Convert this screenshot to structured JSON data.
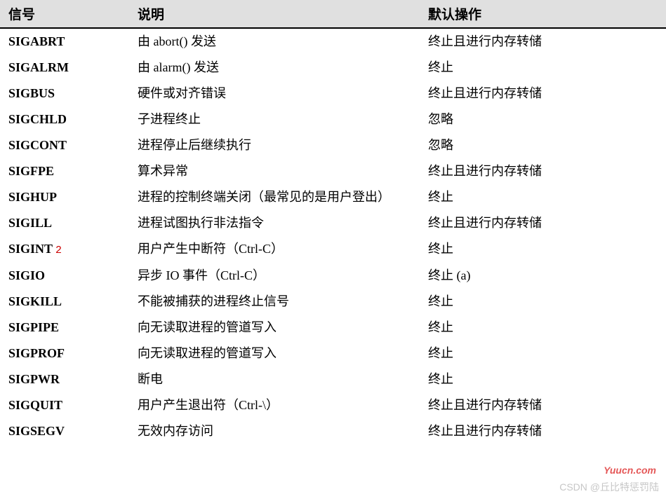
{
  "table": {
    "headers": {
      "signal": "信号",
      "desc": "说明",
      "action": "默认操作"
    },
    "rows": [
      {
        "signal": "SIGABRT",
        "annot": "",
        "desc": "由 abort() 发送",
        "action": "终止且进行内存转储"
      },
      {
        "signal": "SIGALRM",
        "annot": "",
        "desc": "由 alarm() 发送",
        "action": "终止"
      },
      {
        "signal": "SIGBUS",
        "annot": "",
        "desc": "硬件或对齐错误",
        "action": "终止且进行内存转储"
      },
      {
        "signal": "SIGCHLD",
        "annot": "",
        "desc": "子进程终止",
        "action": "忽略"
      },
      {
        "signal": "SIGCONT",
        "annot": "",
        "desc": "进程停止后继续执行",
        "action": "忽略"
      },
      {
        "signal": "SIGFPE",
        "annot": "",
        "desc": "算术异常",
        "action": "终止且进行内存转储"
      },
      {
        "signal": "SIGHUP",
        "annot": "",
        "desc": "进程的控制终端关闭（最常见的是用户登出）",
        "action": "终止"
      },
      {
        "signal": "SIGILL",
        "annot": "",
        "desc": "进程试图执行非法指令",
        "action": "终止且进行内存转储"
      },
      {
        "signal": "SIGINT",
        "annot": "2",
        "desc": "用户产生中断符（Ctrl-C）",
        "action": "终止"
      },
      {
        "signal": "SIGIO",
        "annot": "",
        "desc": "异步 IO 事件（Ctrl-C）",
        "action": "终止 (a)"
      },
      {
        "signal": "SIGKILL",
        "annot": "",
        "desc": "不能被捕获的进程终止信号",
        "action": "终止"
      },
      {
        "signal": "SIGPIPE",
        "annot": "",
        "desc": "向无读取进程的管道写入",
        "action": "终止"
      },
      {
        "signal": "SIGPROF",
        "annot": "",
        "desc": "向无读取进程的管道写入",
        "action": "终止"
      },
      {
        "signal": "SIGPWR",
        "annot": "",
        "desc": "断电",
        "action": "终止"
      },
      {
        "signal": "SIGQUIT",
        "annot": "",
        "desc": "用户产生退出符（Ctrl-\\）",
        "action": "终止且进行内存转储"
      },
      {
        "signal": "SIGSEGV",
        "annot": "",
        "desc": "无效内存访问",
        "action": "终止且进行内存转储"
      }
    ]
  },
  "watermarks": {
    "site": "Yuucn.com",
    "author": "CSDN @丘比特惩罚陆"
  }
}
